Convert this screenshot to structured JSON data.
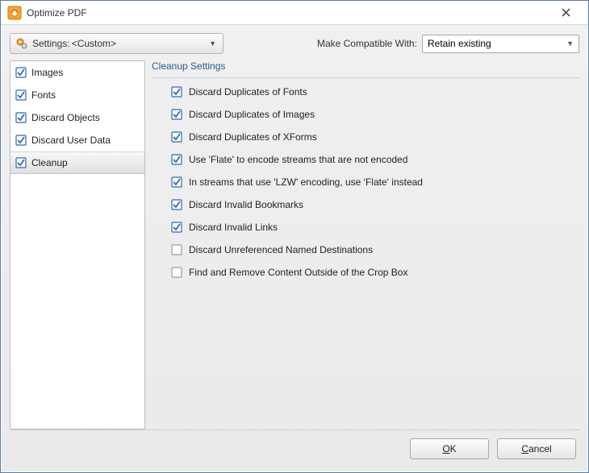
{
  "titlebar": {
    "title": "Optimize PDF"
  },
  "settings": {
    "label": "Settings:",
    "value": "<Custom>"
  },
  "compat": {
    "label": "Make Compatible With:",
    "value": "Retain existing"
  },
  "sidebar": {
    "items": [
      {
        "label": "Images",
        "checked": true
      },
      {
        "label": "Fonts",
        "checked": true
      },
      {
        "label": "Discard Objects",
        "checked": true
      },
      {
        "label": "Discard User Data",
        "checked": true
      },
      {
        "label": "Cleanup",
        "checked": true
      }
    ]
  },
  "panel": {
    "header": "Cleanup Settings",
    "options": [
      {
        "label": "Discard Duplicates of Fonts",
        "checked": true
      },
      {
        "label": "Discard Duplicates of Images",
        "checked": true
      },
      {
        "label": "Discard Duplicates of XForms",
        "checked": true
      },
      {
        "label": "Use 'Flate' to encode streams that are not encoded",
        "checked": true
      },
      {
        "label": "In streams that use 'LZW' encoding, use 'Flate' instead",
        "checked": true
      },
      {
        "label": "Discard Invalid Bookmarks",
        "checked": true
      },
      {
        "label": "Discard Invalid Links",
        "checked": true
      },
      {
        "label": "Discard Unreferenced Named Destinations",
        "checked": false
      },
      {
        "label": "Find and Remove Content Outside of the Crop Box",
        "checked": false
      }
    ]
  },
  "footer": {
    "ok": "OK",
    "cancel": "Cancel"
  }
}
